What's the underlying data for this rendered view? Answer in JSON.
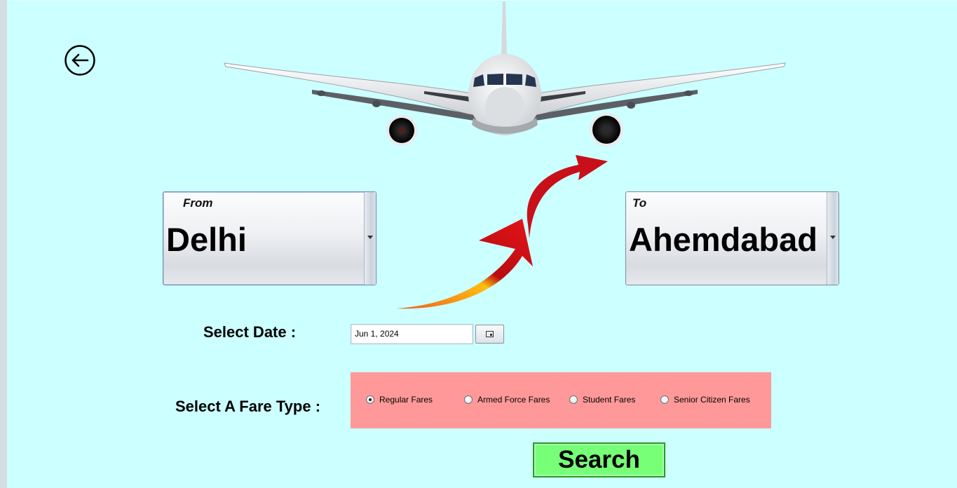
{
  "back": {
    "icon": "back-arrow-icon"
  },
  "images": {
    "plane": "airplane-front-illustration",
    "arrow": "curved-arrow-icon"
  },
  "from": {
    "caption": "From",
    "value": "Delhi"
  },
  "to": {
    "caption": "To",
    "value": "Ahemdabad"
  },
  "date": {
    "label": "Select Date :",
    "value": "Jun 1, 2024",
    "picker_icon": "calendar-icon"
  },
  "fare": {
    "label": "Select A Fare Type :",
    "options": [
      "Regular Fares",
      "Armed Force Fares",
      "Student Fares",
      "Senior Citizen Fares"
    ],
    "selected": "Regular Fares"
  },
  "search": {
    "label": "Search"
  },
  "colors": {
    "background": "#ccffff",
    "fare_panel": "#ff9999",
    "search_button": "#77ff77"
  }
}
